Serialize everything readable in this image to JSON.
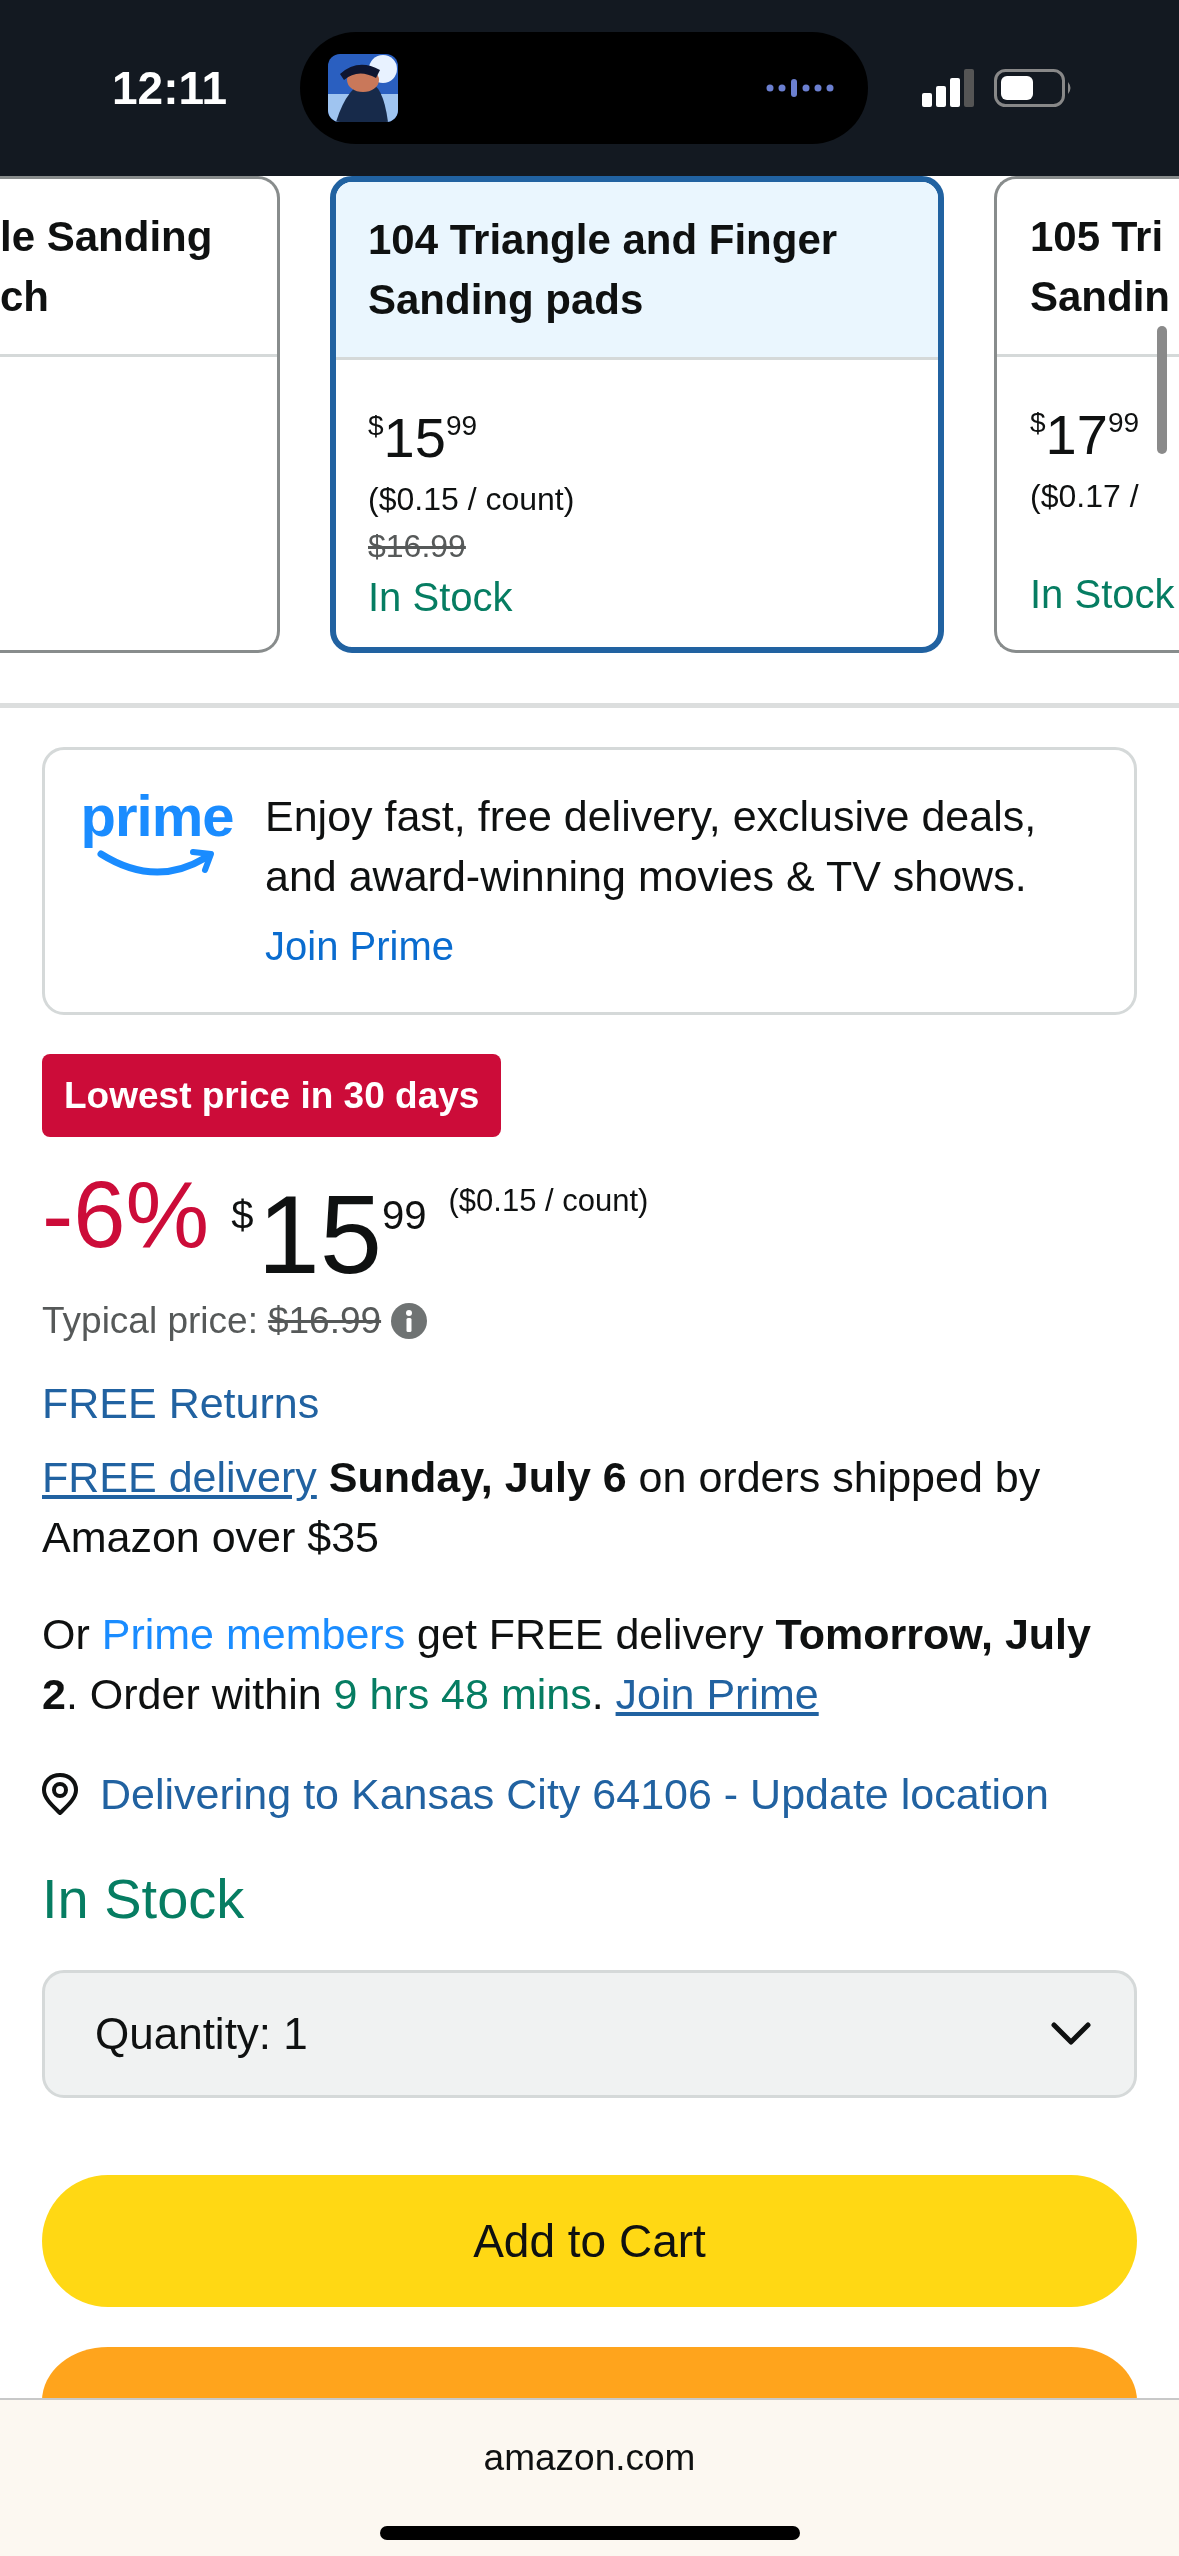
{
  "status_bar": {
    "time": "12:11"
  },
  "variants": [
    {
      "title_lines": [
        "le Sanding",
        "ch"
      ],
      "selected": false
    },
    {
      "title_lines": [
        "104 Triangle and Finger",
        "Sanding pads"
      ],
      "selected": true,
      "price": {
        "symbol": "$",
        "whole": "15",
        "fraction": "99"
      },
      "unit_price": "($0.15 / count)",
      "list_price": "$16.99",
      "availability": "In Stock"
    },
    {
      "title_lines": [
        "105 Tri",
        "Sandin"
      ],
      "selected": false,
      "price": {
        "symbol": "$",
        "whole": "17",
        "fraction": "99"
      },
      "unit_price": "($0.17 /",
      "availability": "In Stock"
    }
  ],
  "prime_promo": {
    "logo": "prime",
    "message": "Enjoy fast, free delivery, exclusive deals, and award-winning movies & TV shows.",
    "link": "Join Prime"
  },
  "deal_badge": "Lowest price in 30 days",
  "price": {
    "discount": "-6%",
    "symbol": "$",
    "whole": "15",
    "fraction": "99",
    "unit_price": "($0.15 / count)"
  },
  "typical_price": {
    "label": "Typical price:",
    "value": "$16.99"
  },
  "free_returns": "FREE Returns",
  "delivery": [
    {
      "kind": "link",
      "text": "FREE delivery"
    },
    {
      "kind": "bold",
      "text": " Sunday, July 6"
    },
    {
      "kind": "plain",
      "text": " on orders shipped by Amazon over $35"
    }
  ],
  "prime_delivery": [
    {
      "kind": "plain",
      "text": "Or "
    },
    {
      "kind": "prime_link",
      "text": "Prime members"
    },
    {
      "kind": "plain",
      "text": " get FREE delivery "
    },
    {
      "kind": "bold",
      "text": "Tomorrow, July 2"
    },
    {
      "kind": "plain",
      "text": ". Order within "
    },
    {
      "kind": "countdown",
      "text": "9 hrs 48 mins"
    },
    {
      "kind": "plain",
      "text": ". "
    },
    {
      "kind": "link",
      "text": "Join Prime"
    }
  ],
  "location": "Delivering to Kansas City 64106 - Update location",
  "availability": "In Stock",
  "quantity": {
    "label": "Quantity:",
    "value": "1"
  },
  "buttons": [
    {
      "kind": "add",
      "label": "Add to Cart"
    },
    {
      "kind": "buy"
    }
  ],
  "browser_bar": {
    "url": "amazon.com"
  }
}
